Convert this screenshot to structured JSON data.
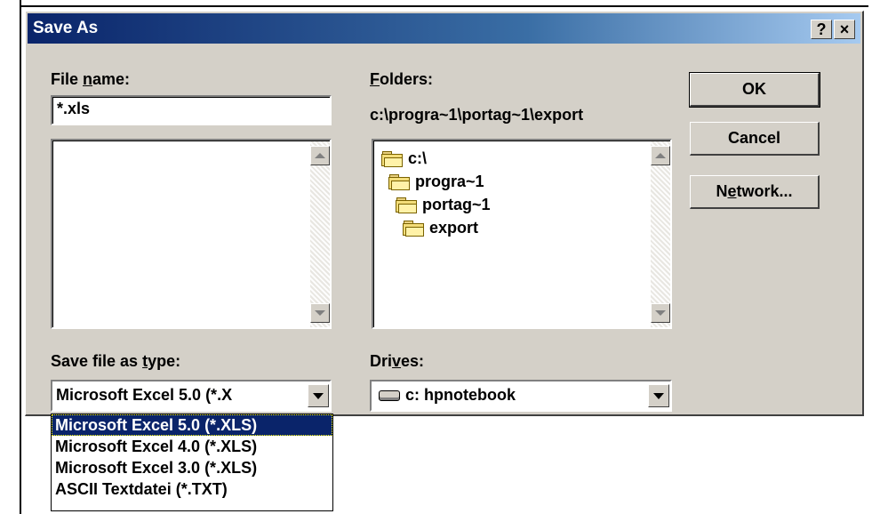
{
  "dialog": {
    "title": "Save As",
    "help_glyph": "?",
    "close_glyph": "×"
  },
  "file_name": {
    "label_pre": "File ",
    "label_ul": "n",
    "label_post": "ame:",
    "value": "*.xls",
    "list_items": []
  },
  "folders": {
    "label_ul": "F",
    "label_post": "olders:",
    "current_path": "c:\\progra~1\\portag~1\\export",
    "items": [
      {
        "label": "c:\\",
        "icon": "open-folder-icon"
      },
      {
        "label": "progra~1",
        "icon": "open-folder-icon"
      },
      {
        "label": "portag~1",
        "icon": "open-folder-icon"
      },
      {
        "label": "export",
        "icon": "open-folder-icon"
      }
    ]
  },
  "buttons": {
    "ok": "OK",
    "cancel": "Cancel",
    "network_pre": "N",
    "network_ul": "e",
    "network_post": "twork..."
  },
  "save_type": {
    "label_pre": "Save file as ",
    "label_ul": "t",
    "label_post": "ype:",
    "selected": "Microsoft Excel 5.0 (*.X",
    "options": [
      "Microsoft Excel 5.0 (*.XLS)",
      "Microsoft Excel 4.0 (*.XLS)",
      "Microsoft Excel 3.0 (*.XLS)",
      "ASCII Textdatei (*.TXT)"
    ],
    "selected_index": 0
  },
  "drives": {
    "label_pre": "Dri",
    "label_ul": "v",
    "label_post": "es:",
    "selected": "c: hpnotebook",
    "icon": "hard-drive-icon"
  },
  "colors": {
    "face": "#d4d0c8",
    "title_start": "#0a246a",
    "title_end": "#a6caf0",
    "selection": "#0a246a"
  }
}
